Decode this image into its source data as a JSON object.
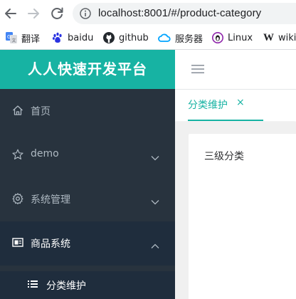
{
  "browser": {
    "url": "localhost:8001/#/product-category",
    "bookmarks": [
      {
        "label": "翻译",
        "icon": "translate-icon"
      },
      {
        "label": "baidu",
        "icon": "baidu-paw-icon"
      },
      {
        "label": "github",
        "icon": "github-icon"
      },
      {
        "label": "服务器",
        "icon": "cloud-icon"
      },
      {
        "label": "Linux",
        "icon": "linux-icon"
      },
      {
        "label": "wiki",
        "icon": "wikipedia-icon",
        "glyph": "W"
      }
    ]
  },
  "app": {
    "brand": "人人快速开发平台",
    "accent_color": "#17b3a3",
    "sidebar_bg": "#28333e",
    "menu": [
      {
        "label": "首页",
        "icon": "home-icon"
      },
      {
        "label": "demo",
        "icon": "star-icon",
        "arrow": "chevron-down-icon"
      },
      {
        "label": "系统管理",
        "icon": "gear-icon",
        "arrow": "chevron-down-icon"
      },
      {
        "label": "商品系统",
        "icon": "monitor-icon",
        "arrow": "chevron-up-icon"
      }
    ],
    "submenu": [
      {
        "label": "分类维护",
        "icon": "list-icon"
      }
    ],
    "tabs": [
      {
        "label": "分类维护",
        "close": "×"
      }
    ],
    "content": {
      "text": "三级分类"
    }
  }
}
